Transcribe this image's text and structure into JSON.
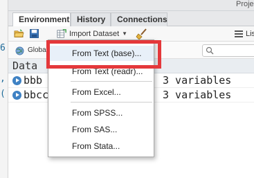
{
  "left_strip": {
    "glyphs": [
      "6",
      ",",
      "("
    ]
  },
  "top": {
    "project_label": "Projec"
  },
  "tabs": [
    {
      "label": "Environment",
      "active": true
    },
    {
      "label": "History",
      "active": false
    },
    {
      "label": "Connections",
      "active": false
    }
  ],
  "toolbar": {
    "import_label": "Import Dataset",
    "list_label": "List"
  },
  "env_bar": {
    "global_env_label": "Global Environment"
  },
  "data_section": {
    "header": "Data",
    "rows": [
      {
        "name": "bbb",
        "value": "3 variables"
      },
      {
        "name": "bbcc",
        "value": "3 variables"
      }
    ]
  },
  "menu": {
    "items": [
      {
        "label": "From Text (base)...",
        "highlighted": true
      },
      {
        "label": "From Text (readr)..."
      },
      {
        "label": "From Excel..."
      },
      {
        "label": "From SPSS..."
      },
      {
        "label": "From SAS..."
      },
      {
        "label": "From Stata..."
      }
    ]
  },
  "colors": {
    "highlight": "#e4383b",
    "accent_blue": "#3f82c4",
    "menu_hover": "#e8f0f9"
  }
}
